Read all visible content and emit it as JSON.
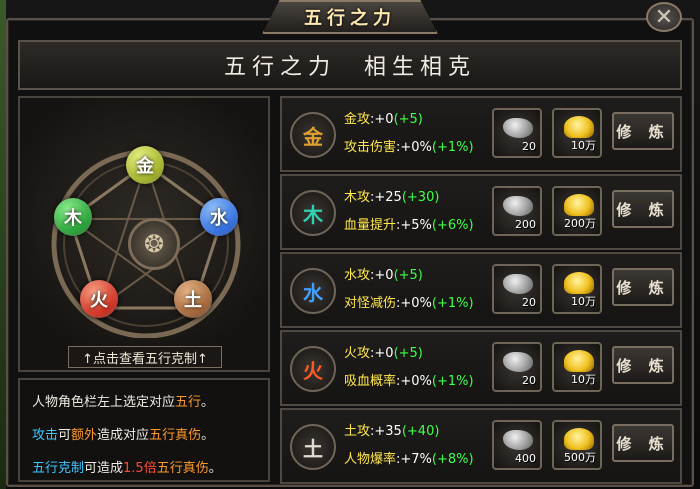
{
  "window": {
    "title": "五行之力",
    "close_glyph": "✕",
    "header": "五行之力　相生相克"
  },
  "wheel": {
    "elements": [
      {
        "name": "metal",
        "glyph": "金",
        "color": "#c8d840"
      },
      {
        "name": "wood",
        "glyph": "木",
        "color": "#2ea040"
      },
      {
        "name": "water",
        "glyph": "水",
        "color": "#2a70e0"
      },
      {
        "name": "fire",
        "glyph": "火",
        "color": "#e03020"
      },
      {
        "name": "earth",
        "glyph": "土",
        "color": "#a86030"
      }
    ],
    "view_button": "↑点击查看五行克制↑"
  },
  "info": {
    "line1_a": "人物角色栏左上选定对应",
    "line1_b": "五行",
    "line1_c": "。",
    "line2_a": "攻击",
    "line2_b": "可",
    "line2_c": "额外",
    "line2_d": "造成对应",
    "line2_e": "五行真伤",
    "line2_f": "。",
    "line3_a": "五行克制",
    "line3_b": "可造成",
    "line3_c": "1.5倍",
    "line3_d": "五行真伤",
    "line3_e": "。"
  },
  "rows": [
    {
      "glyph": "金",
      "glyph_color": "#e0a030",
      "attack_label": "金攻",
      "attack_value": ":+0",
      "attack_bonus": "(+5)",
      "stat_label": "攻击伤害",
      "stat_value": ":+0%",
      "stat_bonus": "(+1%)",
      "ore": "20",
      "gold": "10万",
      "train": "修 炼"
    },
    {
      "glyph": "木",
      "glyph_color": "#30d0b0",
      "attack_label": "木攻",
      "attack_value": ":+25",
      "attack_bonus": "(+30)",
      "stat_label": "血量提升",
      "stat_value": ":+5%",
      "stat_bonus": "(+6%)",
      "ore": "200",
      "gold": "200万",
      "train": "修 炼"
    },
    {
      "glyph": "水",
      "glyph_color": "#40a0ff",
      "attack_label": "水攻",
      "attack_value": ":+0",
      "attack_bonus": "(+5)",
      "stat_label": "对怪减伤",
      "stat_value": ":+0%",
      "stat_bonus": "(+1%)",
      "ore": "20",
      "gold": "10万",
      "train": "修 炼"
    },
    {
      "glyph": "火",
      "glyph_color": "#ff5a20",
      "attack_label": "火攻",
      "attack_value": ":+0",
      "attack_bonus": "(+5)",
      "stat_label": "吸血概率",
      "stat_value": ":+0%",
      "stat_bonus": "(+1%)",
      "ore": "20",
      "gold": "10万",
      "train": "修 炼"
    },
    {
      "glyph": "土",
      "glyph_color": "#e0dcd0",
      "attack_label": "土攻",
      "attack_value": ":+35",
      "attack_bonus": "(+40)",
      "stat_label": "人物爆率",
      "stat_value": ":+7%",
      "stat_bonus": "(+8%)",
      "ore": "400",
      "gold": "500万",
      "train": "修 炼"
    }
  ]
}
